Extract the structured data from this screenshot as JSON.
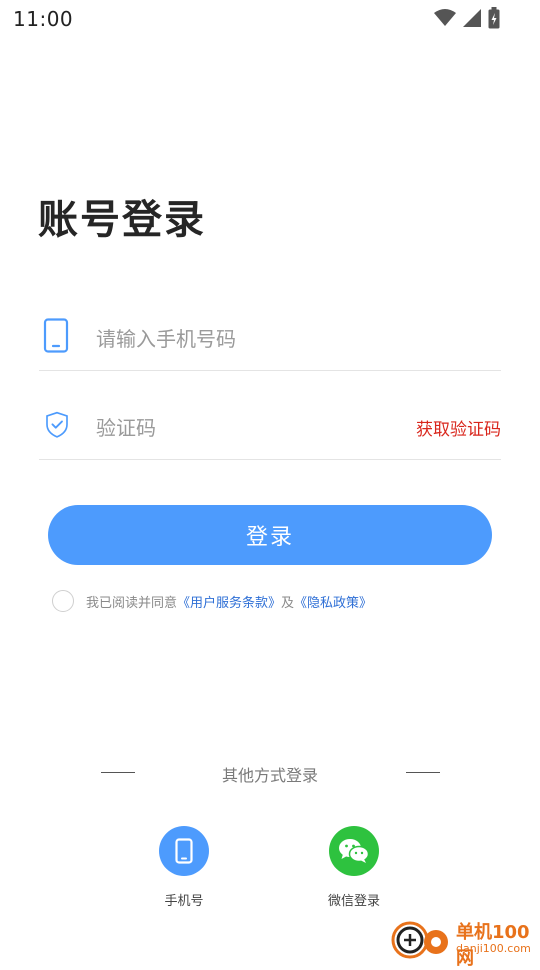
{
  "status_bar": {
    "time": "11:00"
  },
  "title": "账号登录",
  "phone_field": {
    "placeholder": "请输入手机号码",
    "value": ""
  },
  "code_field": {
    "placeholder": "验证码",
    "value": "",
    "get_code_label": "获取验证码"
  },
  "login_button": "登录",
  "agreement": {
    "prefix": "我已阅读并同意",
    "terms_link": "《用户服务条款》",
    "conjunction": "及",
    "privacy_link": "《隐私政策》",
    "checked": false
  },
  "other_login": {
    "label": "其他方式登录",
    "options": [
      {
        "label": "手机号",
        "icon": "phone-icon",
        "color": "#4d9bfd"
      },
      {
        "label": "微信登录",
        "icon": "wechat-icon",
        "color": "#2ec23f"
      }
    ]
  },
  "watermark": {
    "name": "单机100网",
    "url": "danji100.com"
  },
  "colors": {
    "accent": "#4d9bfd",
    "link": "#2e6fd6",
    "code_red": "#d9261c",
    "wechat_green": "#2ec23f"
  }
}
